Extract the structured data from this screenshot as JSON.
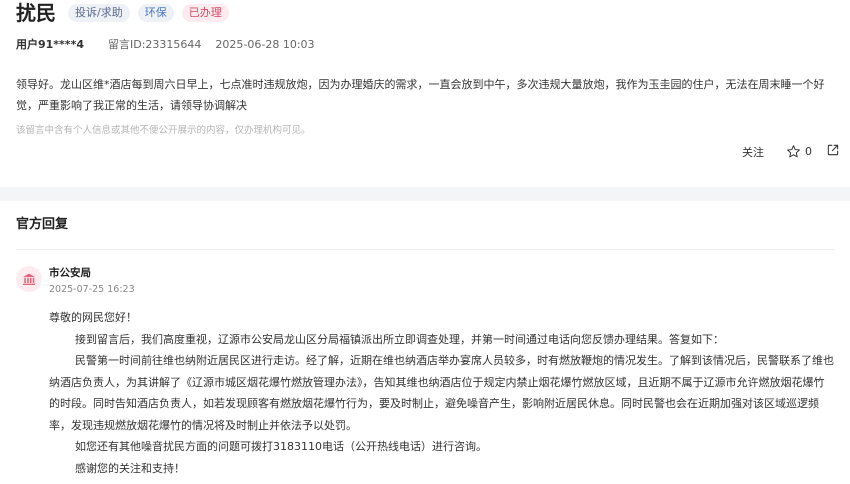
{
  "post": {
    "title": "扰民",
    "tags": [
      "投诉/求助",
      "环保",
      "已办理"
    ],
    "user": "用户91****4",
    "message_id": "留言ID:23315644",
    "datetime": "2025-06-28 10:03",
    "content": "领导好。龙山区维*酒店每到周六日早上，七点准时违规放炮，因为办理婚庆的需求，一直会放到中午，多次违规大量放炮，我作为玉圭园的住户，无法在周末睡一个好觉，严重影响了我正常的生活，请领导协调解决",
    "privacy_note": "该留言中含有个人信息或其他不便公开展示的内容，仅办理机构可见。",
    "follow_label": "关注",
    "star_count": "0"
  },
  "official": {
    "section_title": "官方回复",
    "org_name": "市公安局",
    "reply_time": "2025-07-25 16:23",
    "greeting": "尊敬的网民您好！",
    "paragraphs": [
      "接到留言后，我们高度重视，辽源市公安局龙山区分局福镇派出所立即调查处理，并第一时间通过电话向您反馈办理结果。答复如下：",
      "民警第一时间前往维也纳附近居民区进行走访。经了解，近期在维也纳酒店举办宴席人员较多，时有燃放鞭炮的情况发生。了解到该情况后，民警联系了维也纳酒店负责人，为其讲解了《辽源市城区烟花爆竹燃放管理办法》，告知其维也纳酒店位于规定内禁止烟花爆竹燃放区域，且近期不属于辽源市允许燃放烟花爆竹的时段。同时告知酒店负责人，如若发现顾客有燃放烟花爆竹行为，要及时制止，避免噪音产生，影响附近居民休息。同时民警也会在近期加强对该区域巡逻频率，发现违规燃放烟花爆竹的情况将及时制止并依法予以处罚。",
      "如您还有其他噪音扰民方面的问题可拨打3183110电话（公开热线电话）进行咨询。",
      "感谢您的关注和支持！"
    ]
  },
  "icons": {
    "star": "star-icon",
    "share": "share-icon",
    "org": "government-building-icon"
  },
  "colors": {
    "tag_red_bg": "#fdecef",
    "tag_red_text": "#d9485f",
    "tag_blue_text": "#4a78c0",
    "band_gray": "#f4f5f7"
  }
}
